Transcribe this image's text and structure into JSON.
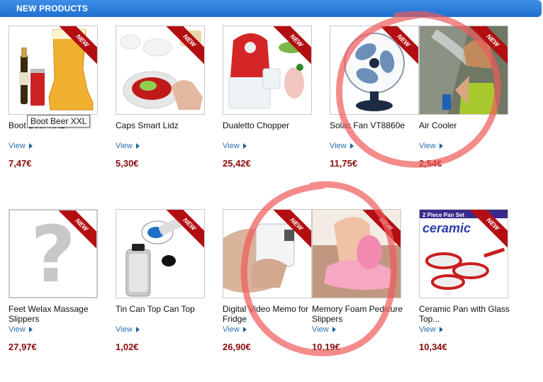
{
  "header": {
    "title": "NEW PRODUCTS"
  },
  "badge": "NEW",
  "view_label": "View",
  "tooltip": "Boot Beer XXL",
  "products": [
    {
      "name": "Boot Beer XXL",
      "price": "7,47€"
    },
    {
      "name": "Caps Smart Lidz",
      "price": "5,30€"
    },
    {
      "name": "Dualetto Chopper",
      "price": "25,42€"
    },
    {
      "name": "Solac Fan VT8860e",
      "price": "11,75€"
    },
    {
      "name": "Air Cooler",
      "price": "2,54€"
    },
    {
      "name": "Feet Welax Massage Slippers",
      "price": "27,97€"
    },
    {
      "name": "Tin Can Top Can Top",
      "price": "1,02€"
    },
    {
      "name": "Digital Video Memo for Fridge",
      "price": "26,90€"
    },
    {
      "name": "Memory Foam Pedicure Slippers",
      "price": "10,19€"
    },
    {
      "name": "Ceramic Pan with Glass Top...",
      "price": "10,34€"
    }
  ],
  "image_text": {
    "ceramic_banner": "2 Piece Pan Set",
    "ceramic_brand": "ceramic"
  },
  "colors": {
    "header": "#2a7fe0",
    "price": "#8a0c0c",
    "ribbon": "#b30f13",
    "link": "#2a6fb0",
    "annotation": "#f05a5a"
  }
}
